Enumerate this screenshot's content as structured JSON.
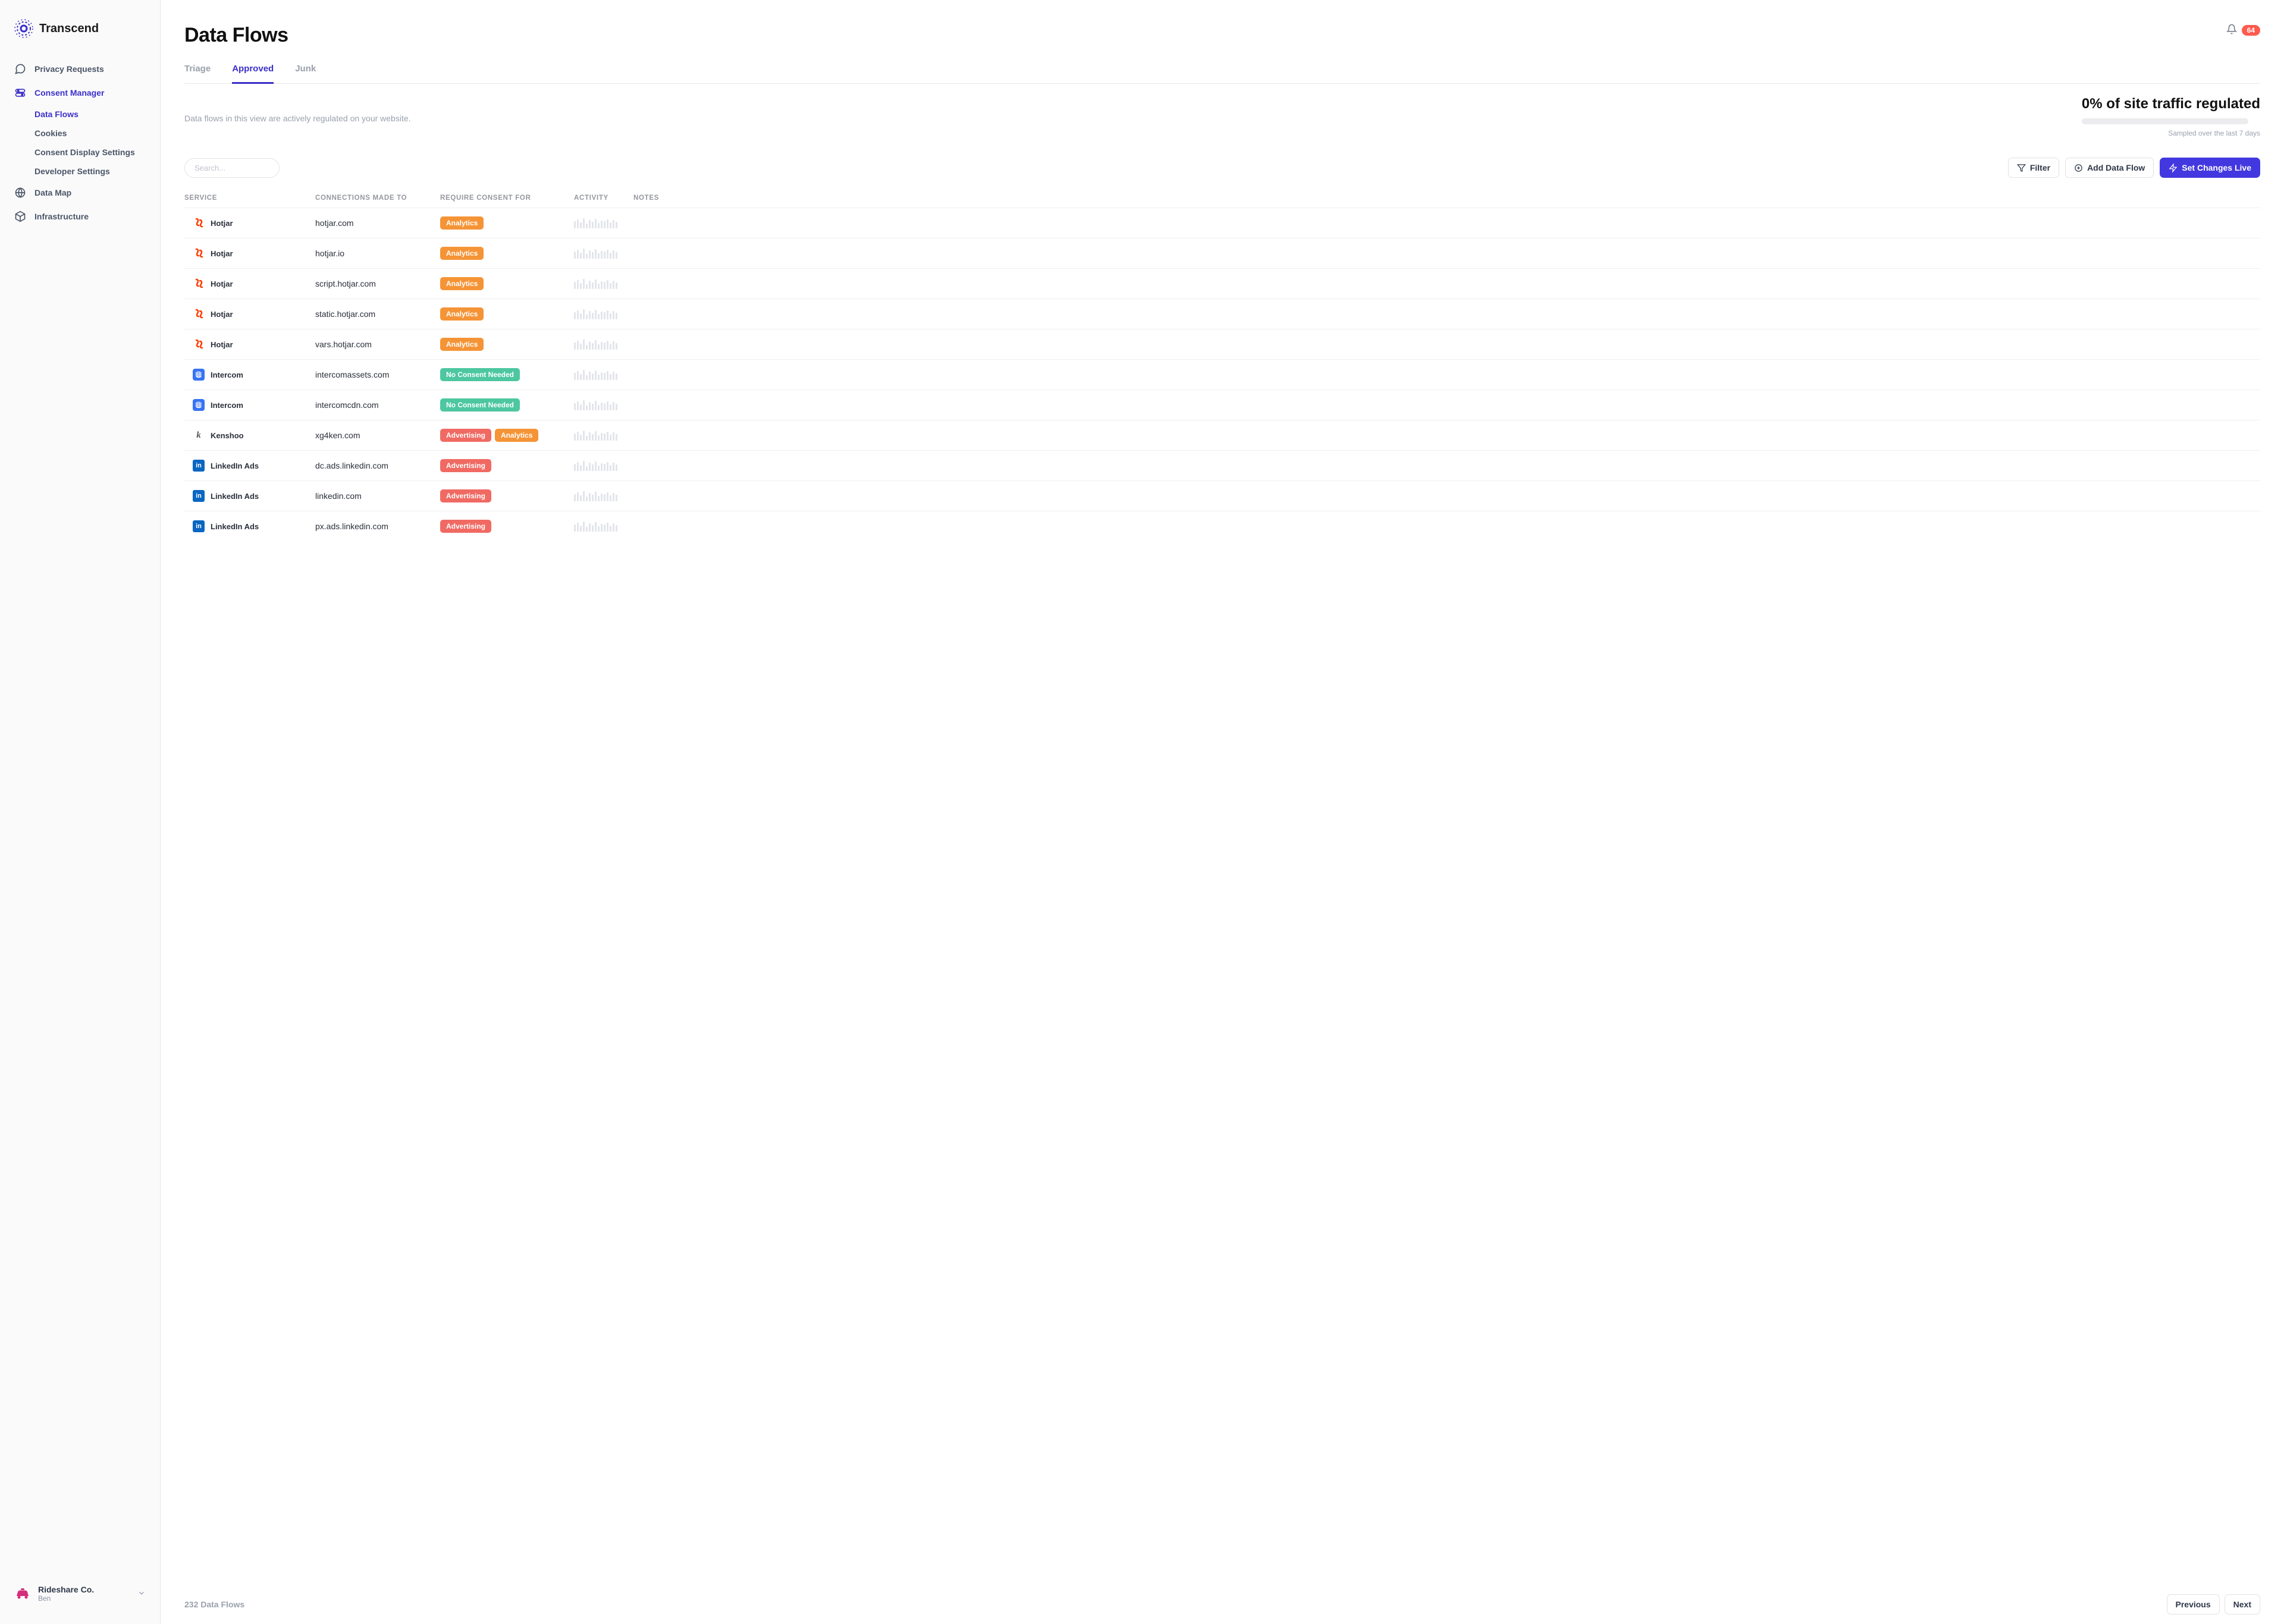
{
  "brand": "Transcend",
  "notifications": {
    "count": "64"
  },
  "sidebar": {
    "items": [
      {
        "label": "Privacy Requests"
      },
      {
        "label": "Consent Manager"
      },
      {
        "label": "Data Map"
      },
      {
        "label": "Infrastructure"
      }
    ],
    "consent_sub": [
      {
        "label": "Data Flows"
      },
      {
        "label": "Cookies"
      },
      {
        "label": "Consent Display Settings"
      },
      {
        "label": "Developer Settings"
      }
    ]
  },
  "org": {
    "name": "Rideshare Co.",
    "user": "Ben"
  },
  "page": {
    "title": "Data Flows",
    "tabs": [
      {
        "label": "Triage"
      },
      {
        "label": "Approved"
      },
      {
        "label": "Junk"
      }
    ],
    "description": "Data flows in this view are actively regulated on your website.",
    "stat_title": "0% of site traffic regulated",
    "stat_sub": "Sampled over the last 7 days"
  },
  "toolbar": {
    "search_placeholder": "Search...",
    "filter": "Filter",
    "add": "Add Data Flow",
    "live": "Set Changes Live"
  },
  "columns": {
    "service": "SERVICE",
    "connections": "CONNECTIONS MADE TO",
    "consent": "REQUIRE CONSENT FOR",
    "activity": "ACTIVITY",
    "notes": "NOTES"
  },
  "rows": [
    {
      "service": "Hotjar",
      "logo": "hotjar",
      "conn": "hotjar.com",
      "tags": [
        "Analytics"
      ]
    },
    {
      "service": "Hotjar",
      "logo": "hotjar",
      "conn": "hotjar.io",
      "tags": [
        "Analytics"
      ]
    },
    {
      "service": "Hotjar",
      "logo": "hotjar",
      "conn": "script.hotjar.com",
      "tags": [
        "Analytics"
      ]
    },
    {
      "service": "Hotjar",
      "logo": "hotjar",
      "conn": "static.hotjar.com",
      "tags": [
        "Analytics"
      ]
    },
    {
      "service": "Hotjar",
      "logo": "hotjar",
      "conn": "vars.hotjar.com",
      "tags": [
        "Analytics"
      ]
    },
    {
      "service": "Intercom",
      "logo": "intercom",
      "conn": "intercomassets.com",
      "tags": [
        "No Consent Needed"
      ]
    },
    {
      "service": "Intercom",
      "logo": "intercom",
      "conn": "intercomcdn.com",
      "tags": [
        "No Consent Needed"
      ]
    },
    {
      "service": "Kenshoo",
      "logo": "kenshoo",
      "conn": "xg4ken.com",
      "tags": [
        "Advertising",
        "Analytics"
      ]
    },
    {
      "service": "LinkedIn Ads",
      "logo": "linkedin",
      "conn": "dc.ads.linkedin.com",
      "tags": [
        "Advertising"
      ]
    },
    {
      "service": "LinkedIn Ads",
      "logo": "linkedin",
      "conn": "linkedin.com",
      "tags": [
        "Advertising"
      ]
    },
    {
      "service": "LinkedIn Ads",
      "logo": "linkedin",
      "conn": "px.ads.linkedin.com",
      "tags": [
        "Advertising"
      ]
    }
  ],
  "footer": {
    "count": "232 Data Flows",
    "prev": "Previous",
    "next": "Next"
  },
  "colors": {
    "brand_primary": "#3b2fc9",
    "analytics": "#f59436",
    "noconsent": "#4dc7a0",
    "advertising": "#f06a63",
    "notification_badge": "#ff5a4e"
  }
}
